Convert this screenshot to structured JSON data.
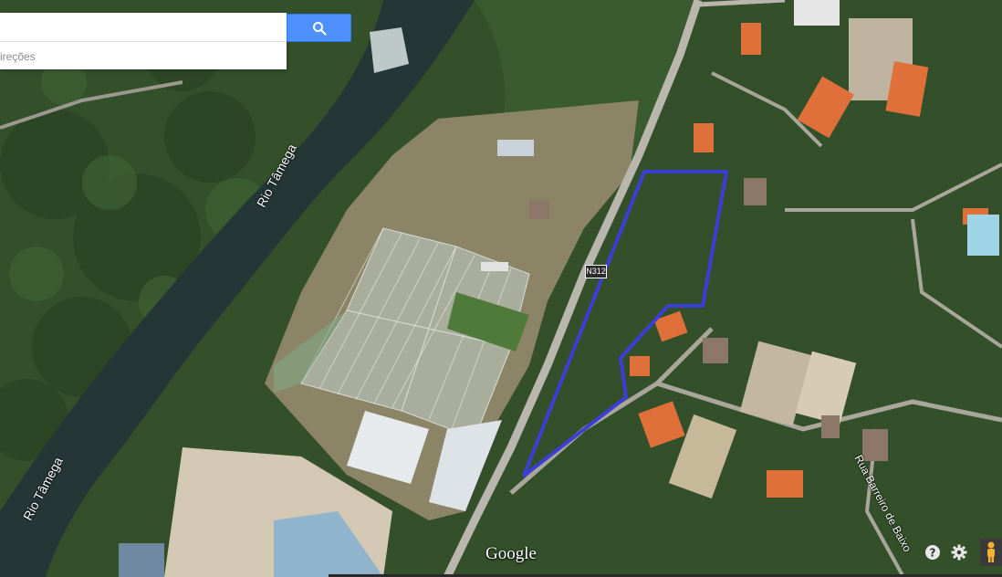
{
  "search": {
    "value": "",
    "placeholder": "",
    "button_icon": "search-icon",
    "directions_text": "ireções",
    "button_color": "#4d90fe"
  },
  "map": {
    "labels": {
      "river_upper": "Rio Tâmega",
      "river_lower": "Rio Tâmega",
      "street": "Rua Barreiro de Baixo",
      "road_shield": "N312"
    },
    "watermark": "Google",
    "parcel_outline_color": "#3b3fd6"
  },
  "controls": {
    "help_icon": "help-icon",
    "settings_icon": "gear-icon",
    "pegman_icon": "pegman-icon"
  }
}
